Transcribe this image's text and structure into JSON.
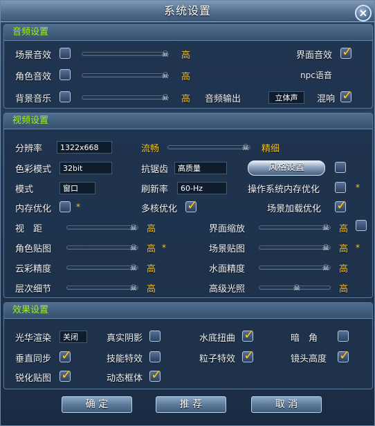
{
  "window": {
    "title": "系统设置",
    "close_icon": "close-icon"
  },
  "audio": {
    "header": "音频设置",
    "scene_sound": "场景音效",
    "role_sound": "角色音效",
    "bg_music": "背景音乐",
    "high": "高",
    "ui_sound": "界面音效",
    "npc_voice": "npc语音",
    "audio_output": "音频输出",
    "output_value": "立体声",
    "reverb": "混响",
    "checks": {
      "scene": false,
      "role": false,
      "bg": false,
      "ui": true,
      "reverb": true
    }
  },
  "video": {
    "header": "视频设置",
    "resolution_label": "分辨率",
    "resolution_value": "1322x668",
    "smooth": "流畅",
    "fine": "精细",
    "color_mode_label": "色彩模式",
    "color_mode_value": "32bit",
    "aa_label": "抗锯齿",
    "aa_value": "高质量",
    "style_button": "风格设置",
    "mode_label": "模式",
    "mode_value": "窗口",
    "refresh_label": "刷新率",
    "refresh_value": "60-Hz",
    "os_mem_opt": "操作系统内存优化",
    "mem_opt": "内存优化",
    "multicore_opt": "多核优化",
    "scene_load_opt": "场景加载优化",
    "view_distance": "视　距",
    "ui_scale": "界面缩放",
    "role_texture": "角色贴图",
    "scene_texture": "场景贴图",
    "cloud_quality": "云彩精度",
    "water_quality": "水面精度",
    "lod": "层次细节",
    "advanced_light": "高级光照",
    "high": "高",
    "star": "*",
    "checks": {
      "style": false,
      "os_mem": false,
      "mem": false,
      "multicore": true,
      "scene_load": true,
      "ui_scale": false
    }
  },
  "effects": {
    "header": "效果设置",
    "glow": "光华渲染",
    "glow_value": "关闭",
    "real_shadow": "真实阴影",
    "underwater_distort": "水底扭曲",
    "vignette": "暗　角",
    "vsync": "垂直同步",
    "skill_fx": "技能特效",
    "particle_fx": "粒子特效",
    "camera_height": "镜头高度",
    "sharpen": "锐化贴图",
    "dynamic_frame": "动态框体",
    "checks": {
      "real_shadow": false,
      "underwater": true,
      "vignette": false,
      "vsync": true,
      "skill_fx": false,
      "particle": true,
      "camera": true,
      "sharpen": true,
      "dynamic": true
    }
  },
  "footer": {
    "ok": "确 定",
    "recommend": "推 荐",
    "cancel": "取 消"
  },
  "colors": {
    "accent_green": "#9df01f",
    "gold": "#f5c431"
  }
}
